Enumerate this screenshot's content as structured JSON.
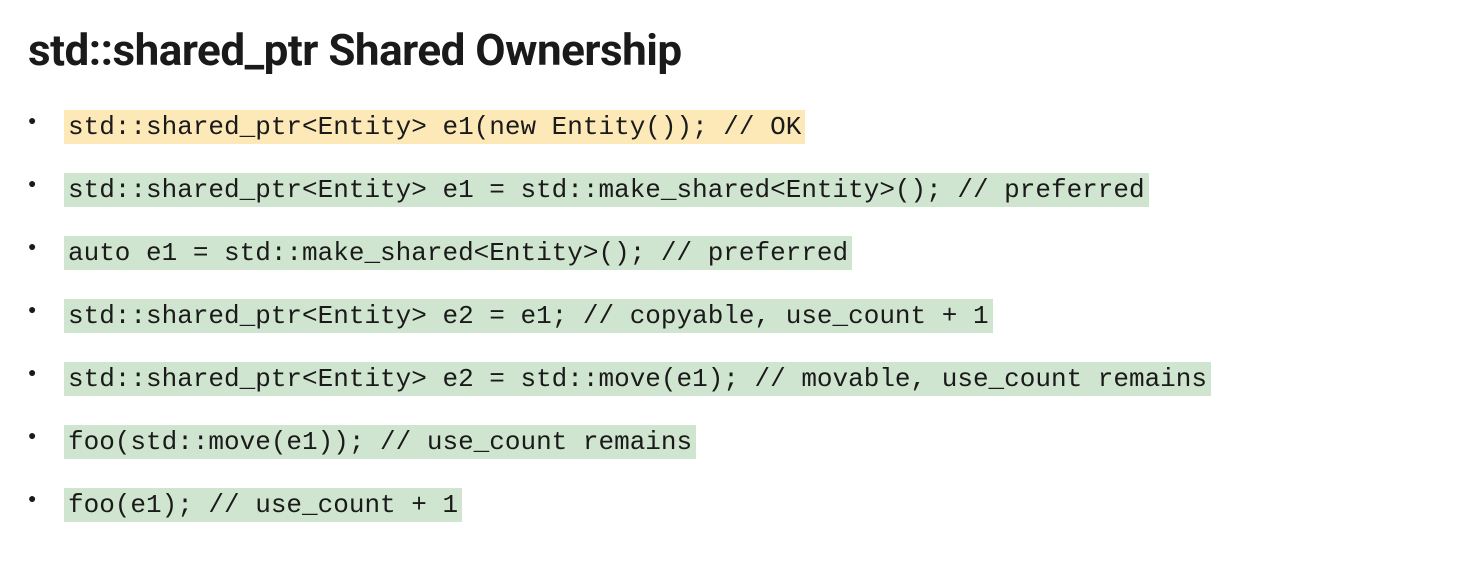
{
  "title": "std::shared_ptr Shared Ownership",
  "items": [
    {
      "code": "std::shared_ptr<Entity> e1(new Entity()); // OK",
      "highlight": "yellow"
    },
    {
      "code": "std::shared_ptr<Entity> e1 = std::make_shared<Entity>(); // preferred",
      "highlight": "green"
    },
    {
      "code": "auto e1 = std::make_shared<Entity>(); // preferred",
      "highlight": "green"
    },
    {
      "code": "std::shared_ptr<Entity> e2 = e1; // copyable, use_count + 1",
      "highlight": "green"
    },
    {
      "code": "std::shared_ptr<Entity> e2 = std::move(e1); // movable, use_count remains",
      "highlight": "green"
    },
    {
      "code": "foo(std::move(e1)); // use_count remains",
      "highlight": "green"
    },
    {
      "code": "foo(e1); // use_count + 1",
      "highlight": "green"
    }
  ]
}
